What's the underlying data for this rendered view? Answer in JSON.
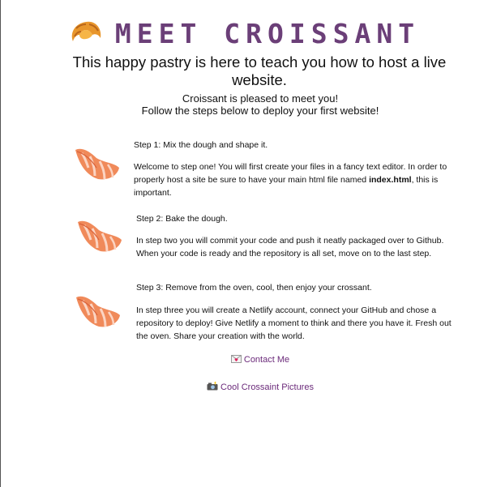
{
  "header": {
    "title": "MEET CROISSANT",
    "subtitle": "This happy pastry is here to teach you how to host a live website."
  },
  "welcome": {
    "line1": "Croissant is pleased to meet you!",
    "line2": "Follow the steps below to deploy your first website!"
  },
  "steps": [
    {
      "heading": "Step 1: Mix the dough and shape it.",
      "body_before": "Welcome to step one! You will first create your files in a fancy text editor. In order to properly host a site be sure to have your main html file named ",
      "body_bold": "index.html",
      "body_after": ", this is important."
    },
    {
      "heading": "Step 2: Bake the dough.",
      "body": "In step two you will commit your code and push it neatly packaged over to Github. When your code is ready and the repository is all set, move on to the last step."
    },
    {
      "heading": "Step 3: Remove from the oven, cool, then enjoy your crossant.",
      "body": "In step three you will create a Netlify account, connect your GitHub and chose a repository to deploy! Give Netlify a moment to think and there you have it. Fresh out the oven. Share your creation with the world."
    }
  ],
  "links": {
    "contact": {
      "icon": "love-letter-icon",
      "label": "Contact Me"
    },
    "pictures": {
      "icon": "camera-flash-icon",
      "label": "Cool Crossaint Pictures"
    }
  },
  "colors": {
    "title": "#6b3f78",
    "link": "#6b2a7a",
    "croissant_main": "#f08a5a",
    "croissant_light": "#fbd4c2"
  }
}
